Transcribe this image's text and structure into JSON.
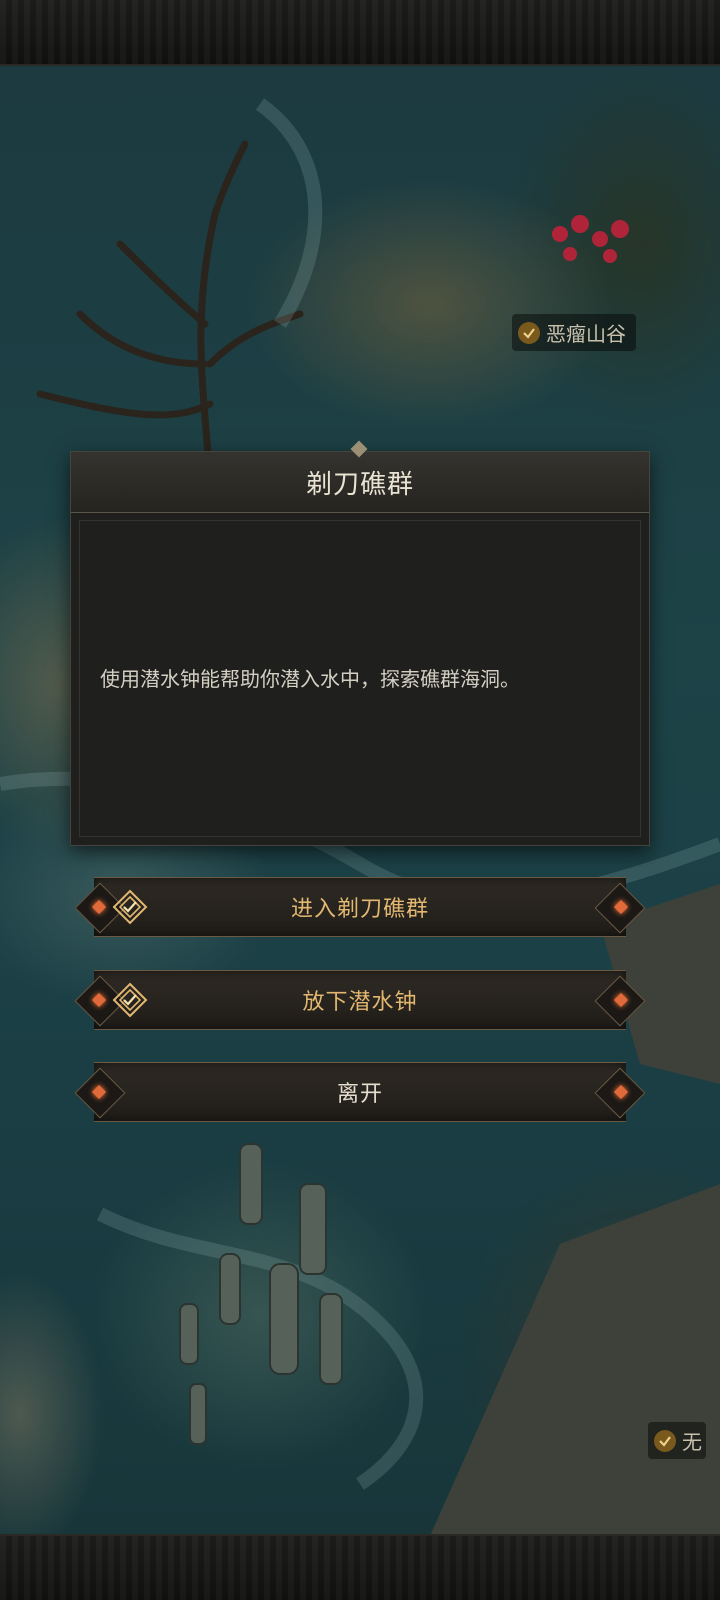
{
  "map": {
    "locations": [
      {
        "name": "恶瘤山谷",
        "visited": true
      },
      {
        "name": "无",
        "visited": true
      }
    ]
  },
  "dialog": {
    "title": "剃刀礁群",
    "body": "使用潜水钟能帮助你潜入水中，探索礁群海洞。"
  },
  "options": [
    {
      "label": "进入剃刀礁群",
      "icon": "quest-diamond-icon"
    },
    {
      "label": "放下潜水钟",
      "icon": "quest-diamond-icon"
    },
    {
      "label": "离开",
      "icon": null
    }
  ],
  "colors": {
    "option_text": "#e2b870",
    "gem": "#e06a3a",
    "dialog_bg": "#1f1f1e"
  }
}
